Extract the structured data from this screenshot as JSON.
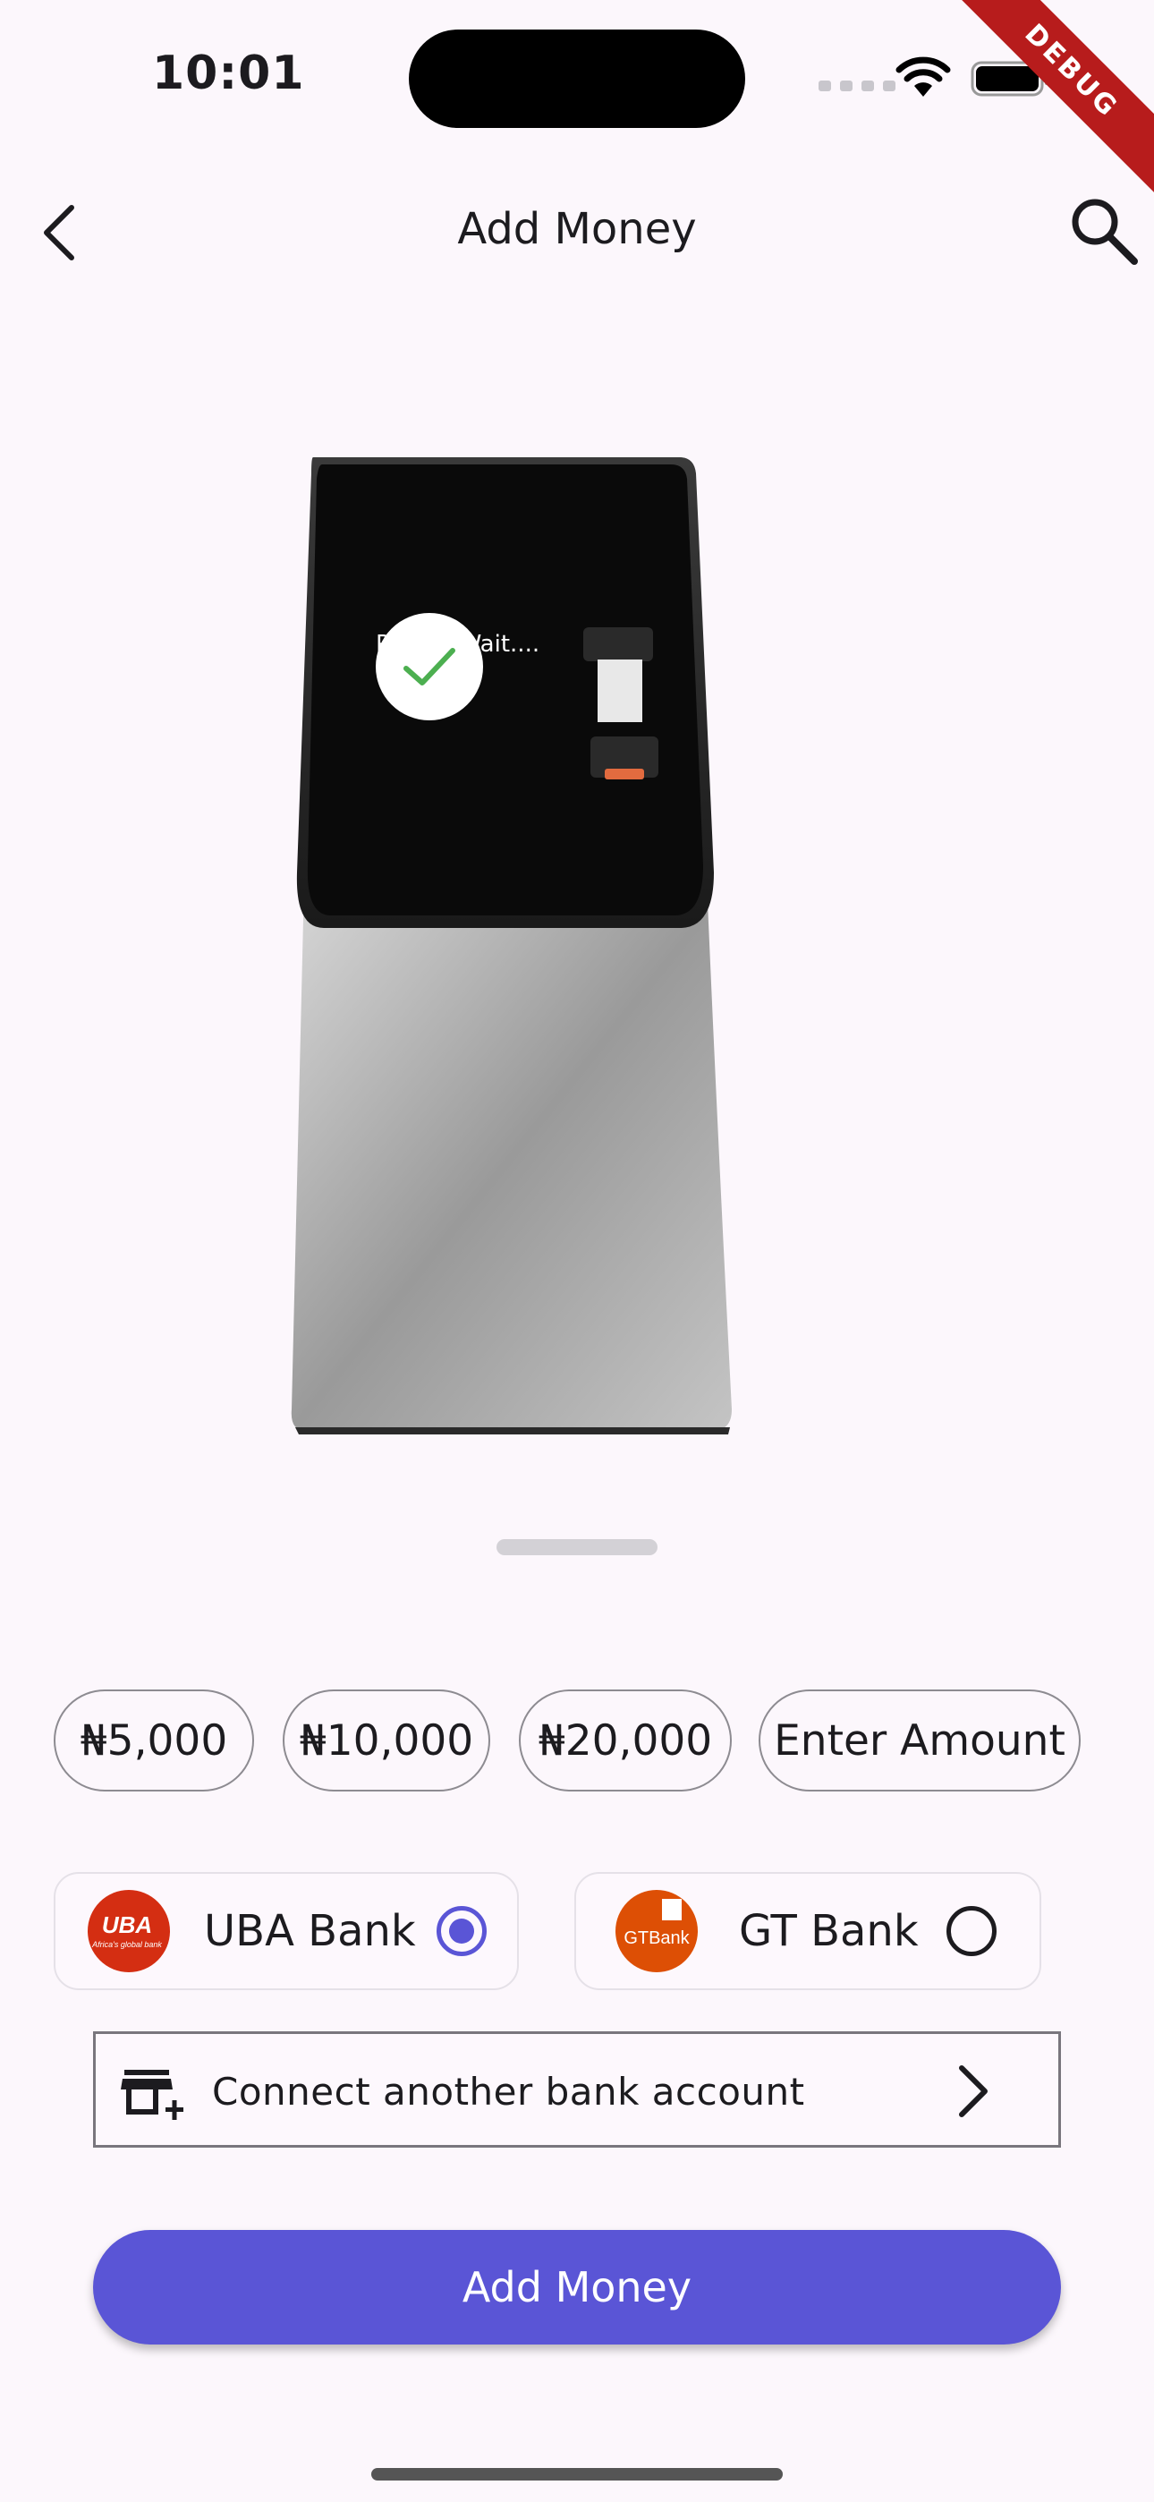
{
  "status_bar": {
    "time": "10:01",
    "debug_label": "DEBUG"
  },
  "app_bar": {
    "title": "Add Money",
    "back_icon": "chevron-left-icon",
    "search_icon": "search-icon"
  },
  "hero": {
    "screen_text": "Please Wait....",
    "check_icon": "check-icon"
  },
  "amount_chips": [
    {
      "label": "₦5,000"
    },
    {
      "label": "₦10,000"
    },
    {
      "label": "₦20,000"
    },
    {
      "label": "Enter Amount"
    }
  ],
  "banks": [
    {
      "name": "UBA Bank",
      "logo_text": "UBA",
      "logo_subtext": "Africa's global bank",
      "logo_color": "#d42e12",
      "selected": true
    },
    {
      "name": "GT Bank",
      "logo_text": "GTBank",
      "logo_color": "#dd4f05",
      "selected": false
    }
  ],
  "connect_bank": {
    "label": "Connect another bank account",
    "icon": "add-business-icon",
    "chevron_icon": "chevron-right-icon"
  },
  "primary_action": {
    "label": "Add Money",
    "color": "#5a55d6"
  },
  "colors": {
    "background": "#fcf7fc",
    "accent": "#5a55d6",
    "radio_selected": "#5a55d6"
  }
}
